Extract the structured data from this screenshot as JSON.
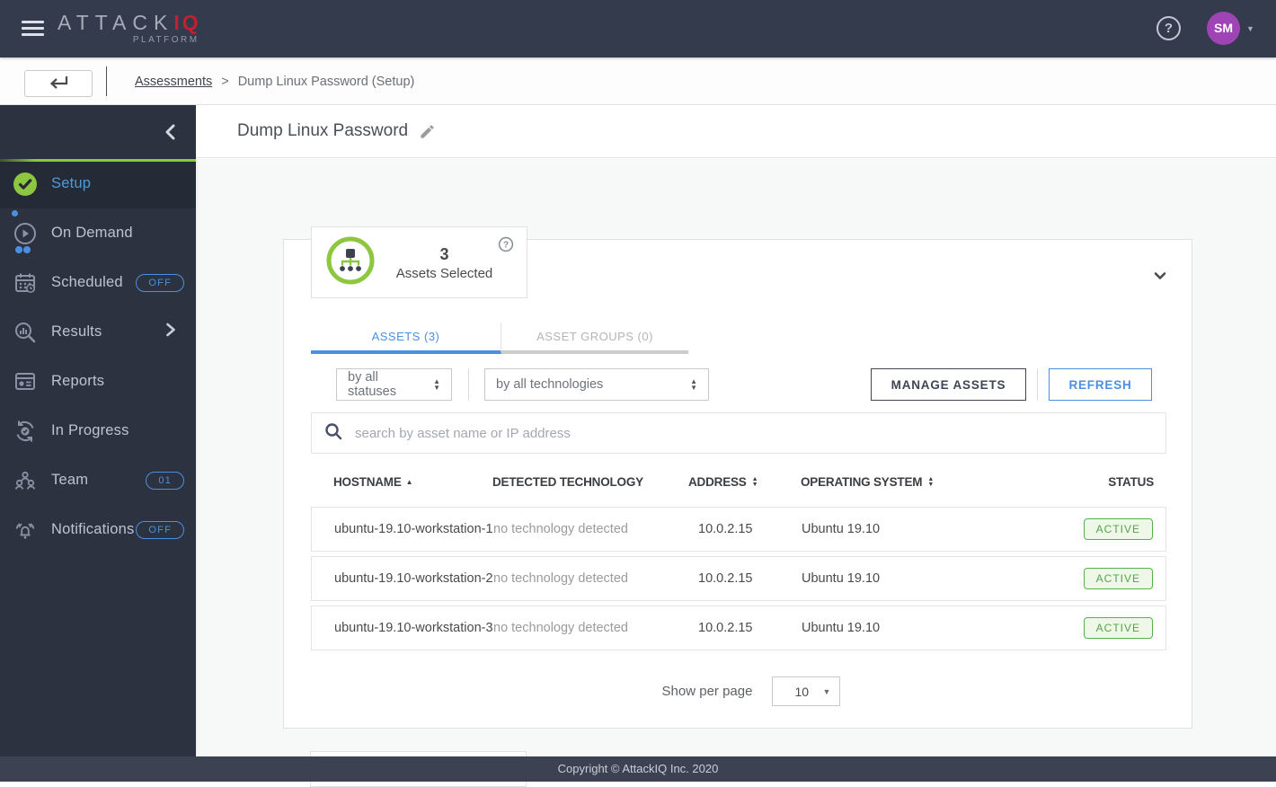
{
  "topbar": {
    "logo_attack": "ATTACK",
    "logo_iq": "IQ",
    "logo_platform": "PLATFORM",
    "avatar_initials": "SM"
  },
  "breadcrumb": {
    "link": "Assessments",
    "separator": ">",
    "current": "Dump Linux Password (Setup)"
  },
  "sidebar": {
    "items": [
      {
        "label": "Setup"
      },
      {
        "label": "On Demand"
      },
      {
        "label": "Scheduled",
        "badge": "OFF"
      },
      {
        "label": "Results"
      },
      {
        "label": "Reports"
      },
      {
        "label": "In Progress"
      },
      {
        "label": "Team",
        "badge": "01"
      },
      {
        "label": "Notifications",
        "badge": "OFF"
      }
    ]
  },
  "page": {
    "title": "Dump Linux Password"
  },
  "assets_panel": {
    "count": "3",
    "count_label": "Assets Selected",
    "tabs": [
      {
        "label": "ASSETS (3)"
      },
      {
        "label": "ASSET GROUPS (0)"
      }
    ],
    "filters": {
      "status": "by all statuses",
      "technology": "by all technologies"
    },
    "actions": {
      "manage": "MANAGE ASSETS",
      "refresh": "REFRESH"
    },
    "search_placeholder": "search by asset name or IP address",
    "table": {
      "columns": [
        "HOSTNAME",
        "DETECTED TECHNOLOGY",
        "ADDRESS",
        "OPERATING SYSTEM",
        "STATUS"
      ],
      "rows": [
        {
          "hostname": "ubuntu-19.10-workstation-1",
          "technology": "no technology detected",
          "address": "10.0.2.15",
          "os": "Ubuntu 19.10",
          "status": "ACTIVE"
        },
        {
          "hostname": "ubuntu-19.10-workstation-2",
          "technology": "no technology detected",
          "address": "10.0.2.15",
          "os": "Ubuntu 19.10",
          "status": "ACTIVE"
        },
        {
          "hostname": "ubuntu-19.10-workstation-3",
          "technology": "no technology detected",
          "address": "10.0.2.15",
          "os": "Ubuntu 19.10",
          "status": "ACTIVE"
        }
      ]
    },
    "pagination": {
      "label": "Show per page",
      "per_page": "10"
    }
  },
  "footer": {
    "copyright": "Copyright © AttackIQ Inc. 2020"
  },
  "icons": {
    "question_mark": "?",
    "sort_asc": "▲",
    "sort_desc": "▼",
    "caret_down": "▼"
  },
  "colors": {
    "topbar_bg": "#333B4D",
    "sidebar_bg": "#2D3240",
    "footer_bg": "#3C4252",
    "brand_red": "#C41E30",
    "accent_green": "#8DC63F",
    "accent_blue": "#4A90E2",
    "avatar_purple": "#9F44B4",
    "status_green": "#51A746"
  }
}
